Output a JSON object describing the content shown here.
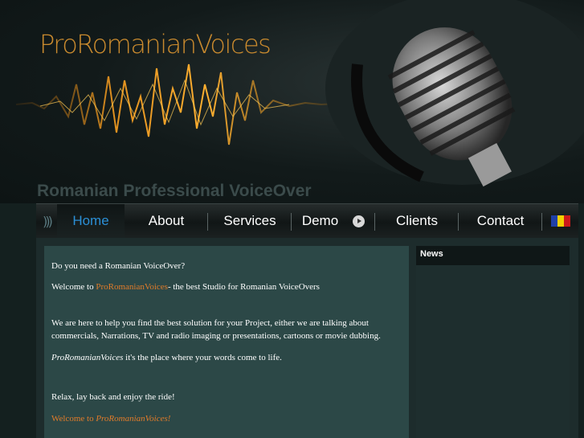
{
  "header": {
    "logo": "ProRomanianVoices",
    "tagline": "Romanian Professional VoiceOver"
  },
  "nav": {
    "items": [
      {
        "label": "Home"
      },
      {
        "label": "About"
      },
      {
        "label": "Services"
      },
      {
        "label": "Demo"
      },
      {
        "label": "Clients"
      },
      {
        "label": "Contact"
      }
    ],
    "language_flag_colors": [
      "#1f3fa8",
      "#f4d000",
      "#cc1a1a"
    ]
  },
  "content": {
    "line1": "Do you need a Romanian VoiceOver?",
    "welcome_prefix": "Welcome to ",
    "welcome_brand": "ProRomanianVoices",
    "welcome_suffix": "- the best Studio for Romanian VoiceOvers",
    "para_help": "We are here to help you find the best solution for your Project, either we are talking about commercials, Narrations, TV and radio imaging or presentations, cartoons or movie dubbing.",
    "place_brand": "ProRomanianVoices",
    "place_suffix": " it's the place where your words come to life.",
    "relax": "Relax, lay back and enjoy the ride!",
    "footer_prefix": "Welcome to ",
    "footer_brand": "ProRomanianVoices!"
  },
  "sidebar": {
    "news_title": "News"
  },
  "colors": {
    "accent": "#e07b2a",
    "nav_active": "#2b8fd6",
    "content_bg": "#2c4847"
  }
}
